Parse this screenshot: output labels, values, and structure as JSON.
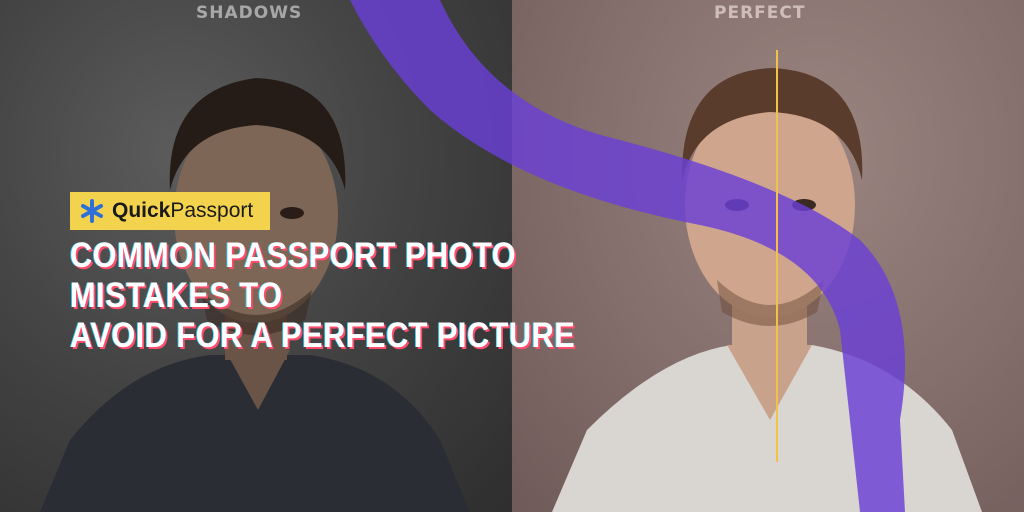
{
  "labels": {
    "left": "SHADOWS",
    "right": "PERFECT"
  },
  "logo": {
    "part1": "Quick",
    "part2": "Passport",
    "icon": "asterisk-logo-icon"
  },
  "headline": {
    "line1": "COMMON PASSPORT PHOTO MISTAKES TO",
    "line2": "AVOID FOR A PERFECT PICTURE"
  },
  "colors": {
    "ribbon": "#6a3fd6",
    "accent_line": "#f0c24a",
    "logo_bg": "#f3d34e",
    "logo_icon": "#2f6fd8"
  }
}
